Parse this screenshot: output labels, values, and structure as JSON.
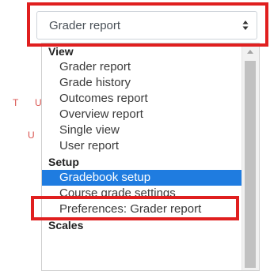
{
  "background": {
    "letters": [
      "T",
      "U",
      "U"
    ]
  },
  "select": {
    "value": "Grader report",
    "arrow_icon": "up-down-arrows-icon"
  },
  "dropdown": {
    "groups": [
      {
        "label": "View",
        "options": [
          "Grader report",
          "Grade history",
          "Outcomes report",
          "Overview report",
          "Single view",
          "User report"
        ]
      },
      {
        "label": "Setup",
        "options": [
          "Gradebook setup",
          "Course grade settings",
          "Preferences: Grader report"
        ]
      },
      {
        "label": "Scales",
        "options": []
      }
    ],
    "selected_option": "Gradebook setup"
  },
  "colors": {
    "highlight_box": "#e01f1f",
    "selected_bg": "#1f7ce0"
  }
}
